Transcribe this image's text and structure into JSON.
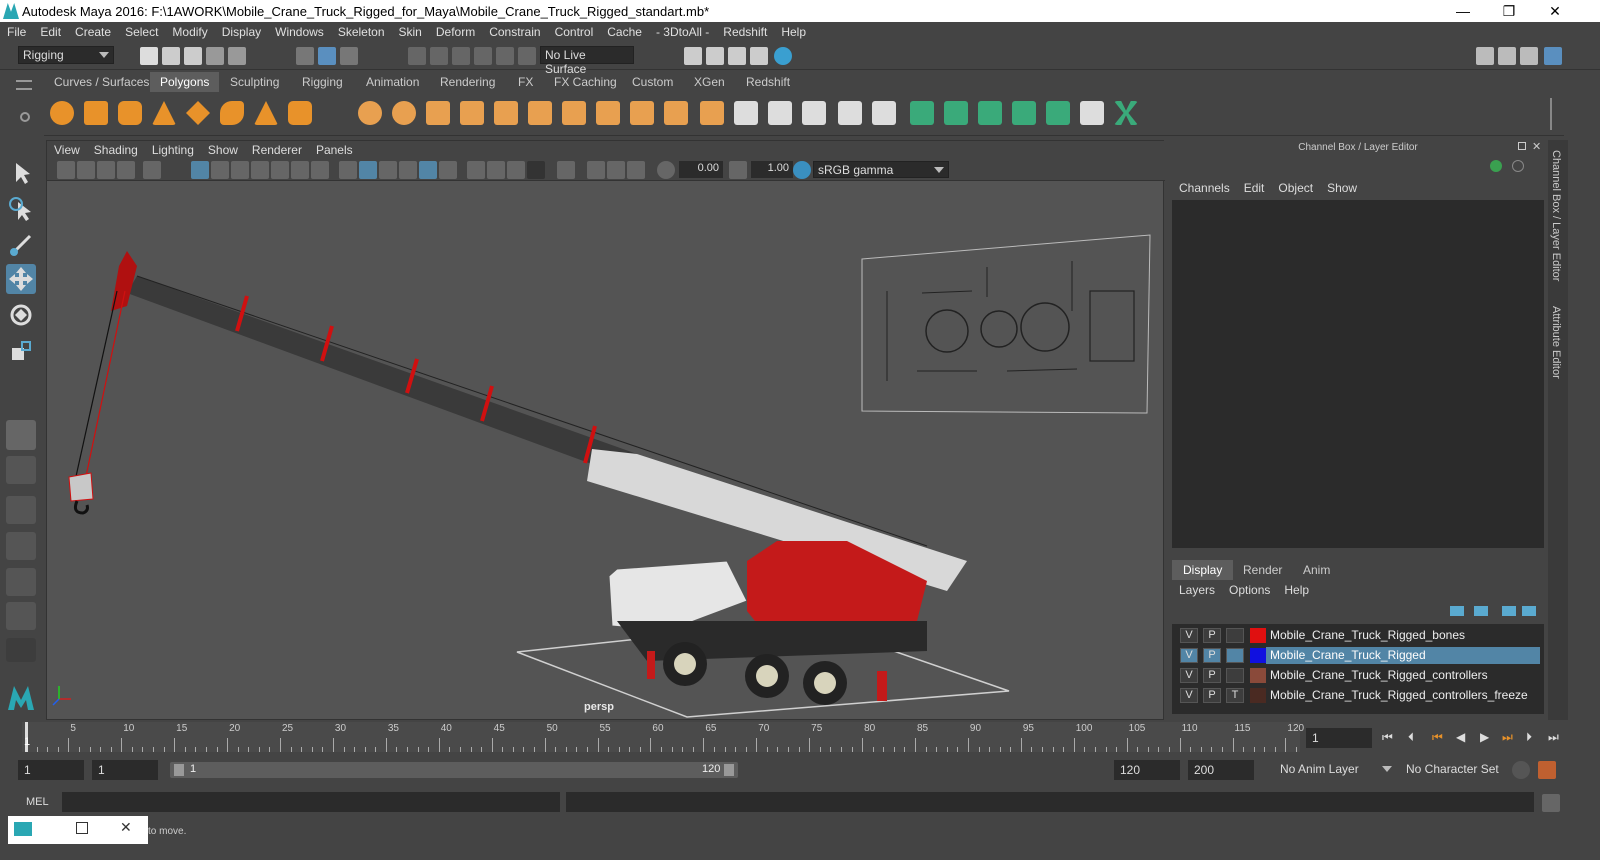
{
  "window": {
    "title": "Autodesk Maya 2016: F:\\1AWORK\\Mobile_Crane_Truck_Rigged_for_Maya\\Mobile_Crane_Truck_Rigged_standart.mb*",
    "min": "—",
    "max": "❐",
    "close": "✕"
  },
  "menu": [
    "File",
    "Edit",
    "Create",
    "Select",
    "Modify",
    "Display",
    "Windows",
    "Skeleton",
    "Skin",
    "Deform",
    "Constrain",
    "Control",
    "Cache",
    "- 3DtoAll -",
    "Redshift",
    "Help"
  ],
  "status": {
    "mode": "Rigging",
    "live_surface": "No Live Surface"
  },
  "shelf_tabs": [
    "Curves / Surfaces",
    "Polygons",
    "Sculpting",
    "Rigging",
    "Animation",
    "Rendering",
    "FX",
    "FX Caching",
    "Custom",
    "XGen",
    "Redshift"
  ],
  "shelf_active": "Polygons",
  "viewport": {
    "menu": [
      "View",
      "Shading",
      "Lighting",
      "Show",
      "Renderer",
      "Panels"
    ],
    "exposure": "0.00",
    "gamma": "1.00",
    "colorspace": "sRGB gamma",
    "camera": "persp"
  },
  "channel": {
    "title": "Channel Box / Layer Editor",
    "menu": [
      "Channels",
      "Edit",
      "Object",
      "Show"
    ]
  },
  "layer_tabs": [
    "Display",
    "Render",
    "Anim"
  ],
  "layer_menu": [
    "Layers",
    "Options",
    "Help"
  ],
  "layers": [
    {
      "v": "V",
      "p": "P",
      "t": "",
      "name": "Mobile_Crane_Truck_Rigged_bones",
      "color": "#e01010",
      "selected": false
    },
    {
      "v": "V",
      "p": "P",
      "t": "",
      "name": "Mobile_Crane_Truck_Rigged",
      "color": "#1010e0",
      "selected": true
    },
    {
      "v": "V",
      "p": "P",
      "t": "",
      "name": "Mobile_Crane_Truck_Rigged_controllers",
      "color": "#8a4a3a",
      "selected": false
    },
    {
      "v": "V",
      "p": "P",
      "t": "T",
      "name": "Mobile_Crane_Truck_Rigged_controllers_freeze",
      "color": "#4a2a22",
      "selected": false
    }
  ],
  "sidetabs": [
    "Channel Box / Layer Editor",
    "Attribute Editor"
  ],
  "timeline": {
    "ticks": [
      "5",
      "10",
      "15",
      "20",
      "25",
      "30",
      "35",
      "40",
      "45",
      "50",
      "55",
      "60",
      "65",
      "70",
      "75",
      "80",
      "85",
      "90",
      "95",
      "100",
      "105",
      "110",
      "115",
      "120"
    ],
    "current_left": "1",
    "current_frame": "1"
  },
  "range": {
    "start": "1",
    "start2": "1",
    "slider_start": "1",
    "slider_end": "120",
    "end": "120",
    "end2": "200",
    "anim_layer": "No Anim Layer",
    "char_set": "No Character Set"
  },
  "mel": {
    "label": "MEL"
  },
  "help": {
    "text": "to move."
  }
}
